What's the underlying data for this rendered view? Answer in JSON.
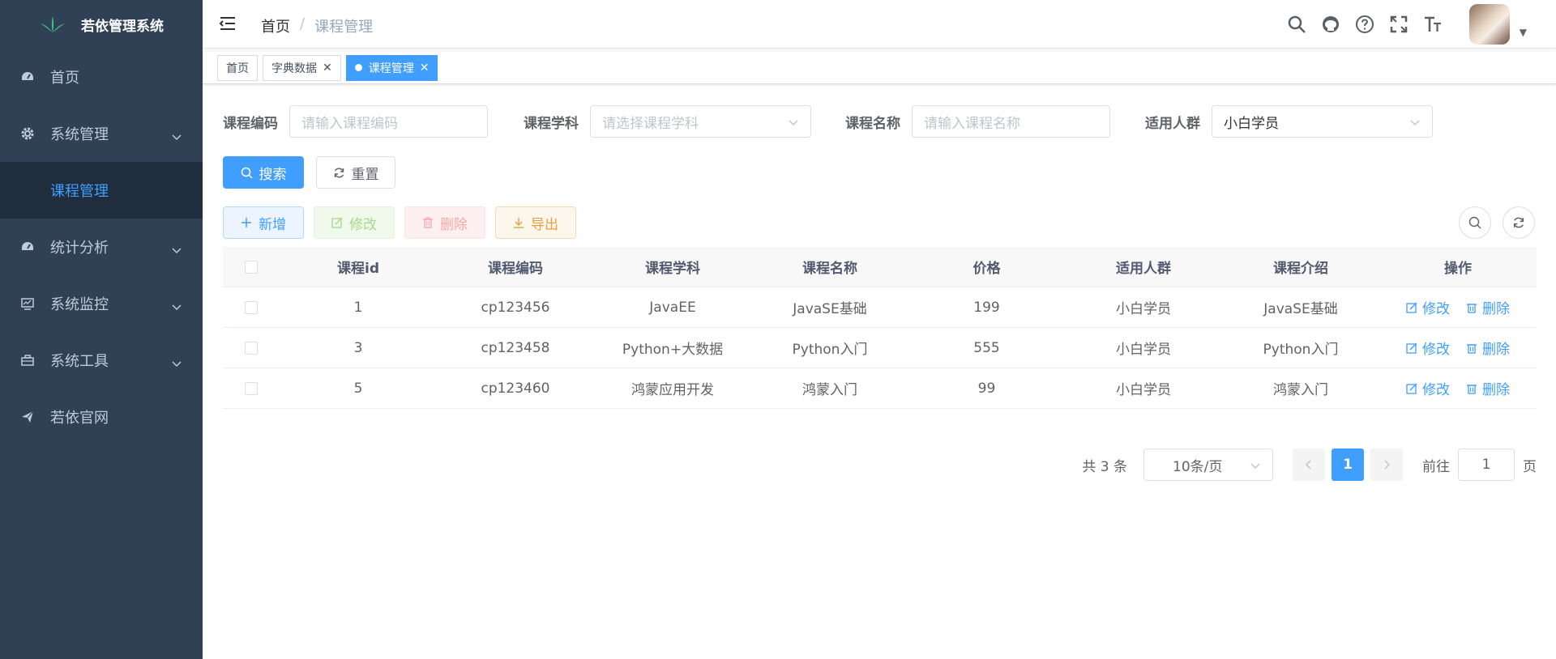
{
  "sidebar": {
    "title": "若依管理系统",
    "items": [
      {
        "label": "首页",
        "icon": "dashboard-icon"
      },
      {
        "label": "系统管理",
        "icon": "gear-icon"
      },
      {
        "label": "课程管理",
        "icon": ""
      },
      {
        "label": "统计分析",
        "icon": "dashboard-icon"
      },
      {
        "label": "系统监控",
        "icon": "monitor-icon"
      },
      {
        "label": "系统工具",
        "icon": "toolbox-icon"
      },
      {
        "label": "若依官网",
        "icon": "paper-plane-icon"
      }
    ],
    "colors": {
      "background": "#304156",
      "active": "#409eff",
      "text": "#bfcbd9"
    }
  },
  "navbar": {
    "breadcrumb": [
      "首页",
      "课程管理"
    ],
    "breadcrumb_sep": "/"
  },
  "tags": [
    {
      "label": "首页"
    },
    {
      "label": "字典数据"
    },
    {
      "label": "课程管理"
    }
  ],
  "search": {
    "code_label": "课程编码",
    "code_placeholder": "请输入课程编码",
    "subject_label": "课程学科",
    "subject_placeholder": "请选择课程学科",
    "name_label": "课程名称",
    "name_placeholder": "请输入课程名称",
    "crowd_label": "适用人群",
    "crowd_value": "小白学员",
    "search_btn": "搜索",
    "reset_btn": "重置"
  },
  "toolbar": {
    "add": "新增",
    "edit": "修改",
    "delete": "删除",
    "export": "导出"
  },
  "table": {
    "headers": [
      "课程id",
      "课程编码",
      "课程学科",
      "课程名称",
      "价格",
      "适用人群",
      "课程介绍",
      "操作"
    ],
    "rows": [
      {
        "id": "1",
        "code": "cp123456",
        "subject": "JavaEE",
        "name": "JavaSE基础",
        "price": "199",
        "crowd": "小白学员",
        "intro": "JavaSE基础"
      },
      {
        "id": "3",
        "code": "cp123458",
        "subject": "Python+大数据",
        "name": "Python入门",
        "price": "555",
        "crowd": "小白学员",
        "intro": "Python入门"
      },
      {
        "id": "5",
        "code": "cp123460",
        "subject": "鸿蒙应用开发",
        "name": "鸿蒙入门",
        "price": "99",
        "crowd": "小白学员",
        "intro": "鸿蒙入门"
      }
    ],
    "op_edit": "修改",
    "op_delete": "删除"
  },
  "pagination": {
    "total": "共 3 条",
    "page_size": "10条/页",
    "current": "1",
    "goto_label": "前往",
    "goto_value": "1",
    "page_unit": "页"
  }
}
